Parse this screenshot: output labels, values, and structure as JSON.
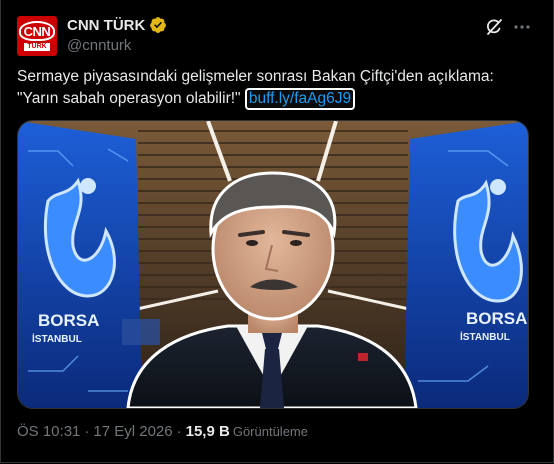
{
  "author": {
    "avatar_line1": "CNN",
    "avatar_line2": "TÜRK",
    "display_name": "CNN TÜRK",
    "handle": "@cnnturk",
    "verified_color": "#e2b719"
  },
  "tweet": {
    "text_line1": "Sermaye piyasasındaki gelişmeler sonrası Bakan Çiftçi'den açıklama:",
    "text_line2": "\"Yarın sabah operasyon olabilir!\"",
    "link": "buff.ly/faAg6J9",
    "link_color": "#1d9bf0"
  },
  "media": {
    "left_sign_line1": "BORSA",
    "left_sign_line2": "İSTANBUL",
    "right_sign_line1": "BORSA",
    "right_sign_line2": "İSTANBUL"
  },
  "meta": {
    "time": "ÖS 10:31",
    "date": "17 Eyl 2026",
    "views_count": "15,9 B",
    "views_label": "Görüntüleme"
  },
  "icons": [
    "verified-badge-icon",
    "grok-icon",
    "more-icon"
  ]
}
